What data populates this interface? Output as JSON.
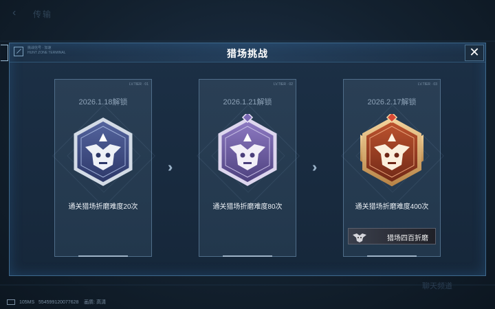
{
  "topbar": {
    "title": "传输"
  },
  "modal": {
    "title": "猎场挑战",
    "header_meta_line1": "挑战信号 · 加速",
    "header_meta_line2": "HUNT ZONE TERMINAL"
  },
  "cards": [
    {
      "unlock_date": "2026.1.18解锁",
      "description": "通关猎场折磨难度20次",
      "tier": "silver-blue",
      "tag": "LV.TIER · 01"
    },
    {
      "unlock_date": "2026.1.21解锁",
      "description": "通关猎场折磨难度80次",
      "tier": "purple",
      "tag": "LV.TIER · 02"
    },
    {
      "unlock_date": "2026.2.17解锁",
      "description": "通关猎场折磨难度400次",
      "tier": "gold-red",
      "tag": "LV.TIER · 03",
      "reward_title": "猎场四百折磨"
    }
  ],
  "status": {
    "ping": "105MS",
    "uid": "554599120077628",
    "quality_label": "画质:",
    "quality_value": "高清"
  },
  "background_ghost": "聊天频道",
  "colors": {
    "accent": "#3e6a8e",
    "card_bg": "#2a3f55",
    "badge_blue": "#3d4f8c",
    "badge_purple": "#6a5b9c",
    "badge_red": "#9a3a25",
    "gold": "#d9ab6d"
  }
}
